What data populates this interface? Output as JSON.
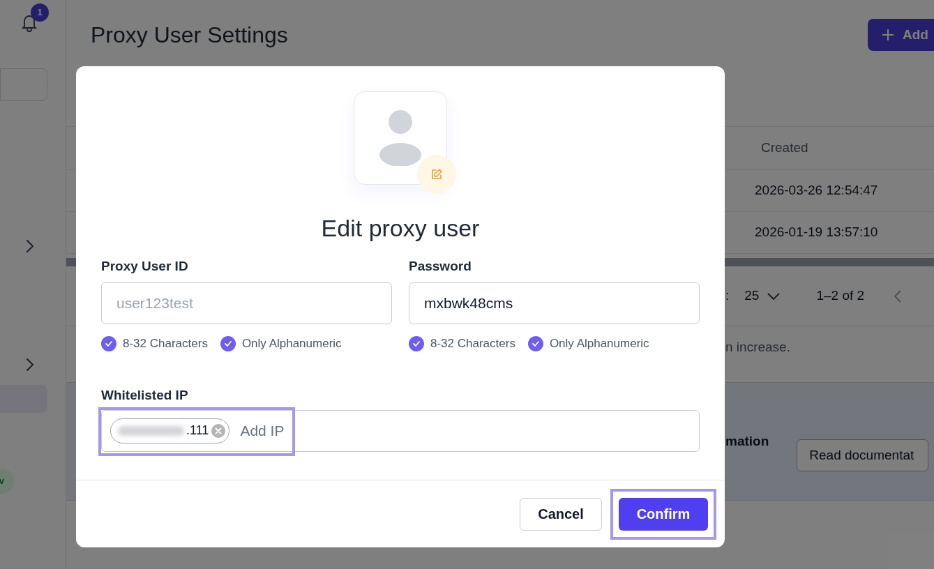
{
  "sidebar": {
    "notification_count": "1",
    "items": [
      {
        "kind": "field"
      },
      {
        "kind": "expander"
      },
      {
        "kind": "expander"
      },
      {
        "kind": "selected"
      }
    ],
    "badge": "v"
  },
  "page": {
    "title": "Proxy User Settings",
    "add_button": "Add",
    "table": {
      "columns": [
        "Created"
      ],
      "rows": [
        [
          "2026-03-26 12:54:47"
        ],
        [
          "2026-01-19 13:57:10"
        ]
      ]
    },
    "pagination": {
      "label": ":",
      "page_size": "25",
      "range": "1–2 of 2"
    },
    "note": "n increase.",
    "info_panel": {
      "text": "mation",
      "button": "Read documentat"
    }
  },
  "dialog": {
    "title": "Edit proxy user",
    "fields": [
      {
        "label": "Proxy User ID",
        "value": "user123test",
        "disabled": true,
        "rules": [
          {
            "text": "8-32 Characters",
            "checked": true
          },
          {
            "text": "Only Alphanumeric",
            "checked": true
          }
        ]
      },
      {
        "label": "Password",
        "value": "mxbwk48cms",
        "disabled": false,
        "rules": [
          {
            "text": "8-32 Characters",
            "checked": true
          },
          {
            "text": "Only Alphanumeric",
            "checked": true
          }
        ]
      }
    ],
    "whitelist": {
      "label": "Whitelisted IP",
      "tags": [
        {
          "text": ".111",
          "redacted": true
        }
      ],
      "placeholder": "Add IP",
      "highlighted": true
    },
    "buttons": [
      {
        "label": "Cancel",
        "kind": "secondary",
        "highlighted": false
      },
      {
        "label": "Confirm",
        "kind": "primary",
        "highlighted": true
      }
    ]
  }
}
